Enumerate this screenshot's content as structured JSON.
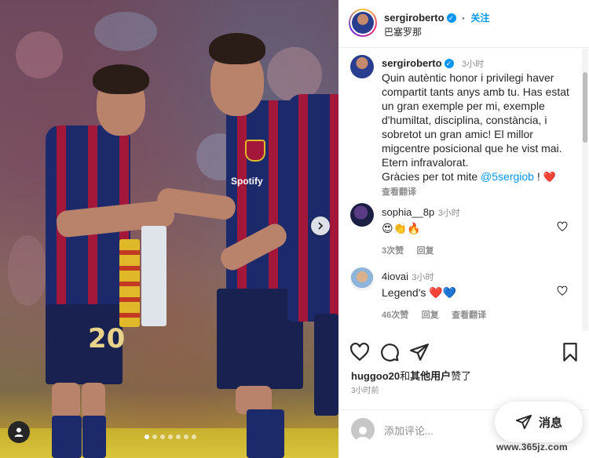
{
  "post": {
    "author": "sergiroberto",
    "follow_label": "关注",
    "separator": "•",
    "location": "巴塞罗那"
  },
  "caption": {
    "username": "sergiroberto",
    "time": "3小时",
    "text": "Quin autèntic honor i privilegi haver compartit tants anys amb tu. Has estat un gran exemple per mi, exemple d'humiltat, disciplina, constància, i sobretot un gran amic! El millor migcentre posicional que he vist mai. Etern infravalorat.",
    "thanks_prefix": "Gràcies per tot mite ",
    "mention": "@5sergiob",
    "thanks_suffix": " !",
    "heart": "❤️",
    "see_translation": "查看翻译"
  },
  "comments": [
    {
      "username": "sophia__8p",
      "time": "3小时",
      "text": "😍👏🔥",
      "likes": "3次赞",
      "reply": "回复"
    },
    {
      "username": "4iovai",
      "time": "3小时",
      "text": "Legend's ❤️💙",
      "likes": "46次赞",
      "reply": "回复",
      "see_translation": "查看翻译"
    }
  ],
  "footer": {
    "likes_user": "huggoo20",
    "likes_and": "和",
    "likes_others": "其他用户",
    "likes_suffix": "赞了",
    "time_ago": "3小时前",
    "comment_placeholder": "添加评论..."
  },
  "photo": {
    "jersey_number": "20",
    "sponsor": "Spotify",
    "carousel_dots": 7,
    "active_dot": 0
  },
  "messages_button": {
    "label": "消息"
  },
  "watermark": "www.365jz.com",
  "icons": {
    "next": "chevron-right-icon",
    "like": "heart-icon",
    "comment": "comment-icon",
    "share": "send-icon",
    "save": "bookmark-icon",
    "messages": "paper-plane-icon",
    "user_tag": "person-icon"
  },
  "colors": {
    "accent": "#0095f6",
    "heart": "#ed4956",
    "blue_heart": "#3797f0"
  }
}
